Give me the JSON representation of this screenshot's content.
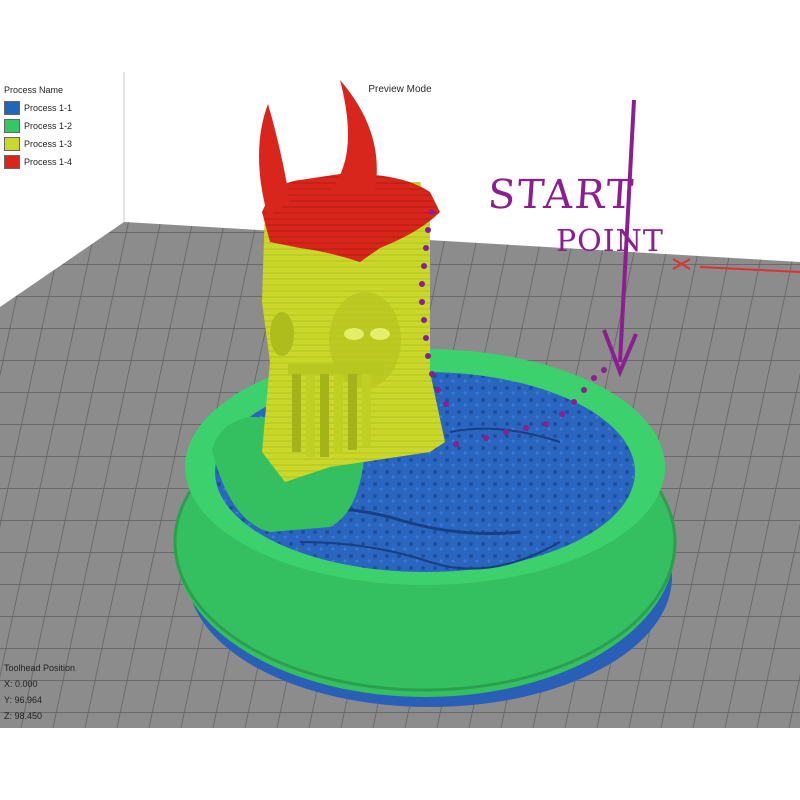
{
  "header": {
    "preview_mode": "Preview Mode"
  },
  "legend": {
    "title": "Process Name",
    "items": [
      {
        "label": "Process 1-1",
        "color": "#2166b8"
      },
      {
        "label": "Process 1-2",
        "color": "#36c765"
      },
      {
        "label": "Process 1-3",
        "color": "#c9d82a"
      },
      {
        "label": "Process 1-4",
        "color": "#d9261c"
      }
    ]
  },
  "toolhead": {
    "title": "Toolhead Position",
    "x": "X: 0.000",
    "y": "Y: 96.964",
    "z": "Z: 98.450"
  },
  "annotation": {
    "line1": "START",
    "line2": "POINT",
    "color": "#8b1f8f"
  },
  "scene": {
    "bed_color": "#8c8c8c",
    "grid_color": "#5e5e5e",
    "icons": [
      "build-plate",
      "origin-axis-marker"
    ]
  }
}
